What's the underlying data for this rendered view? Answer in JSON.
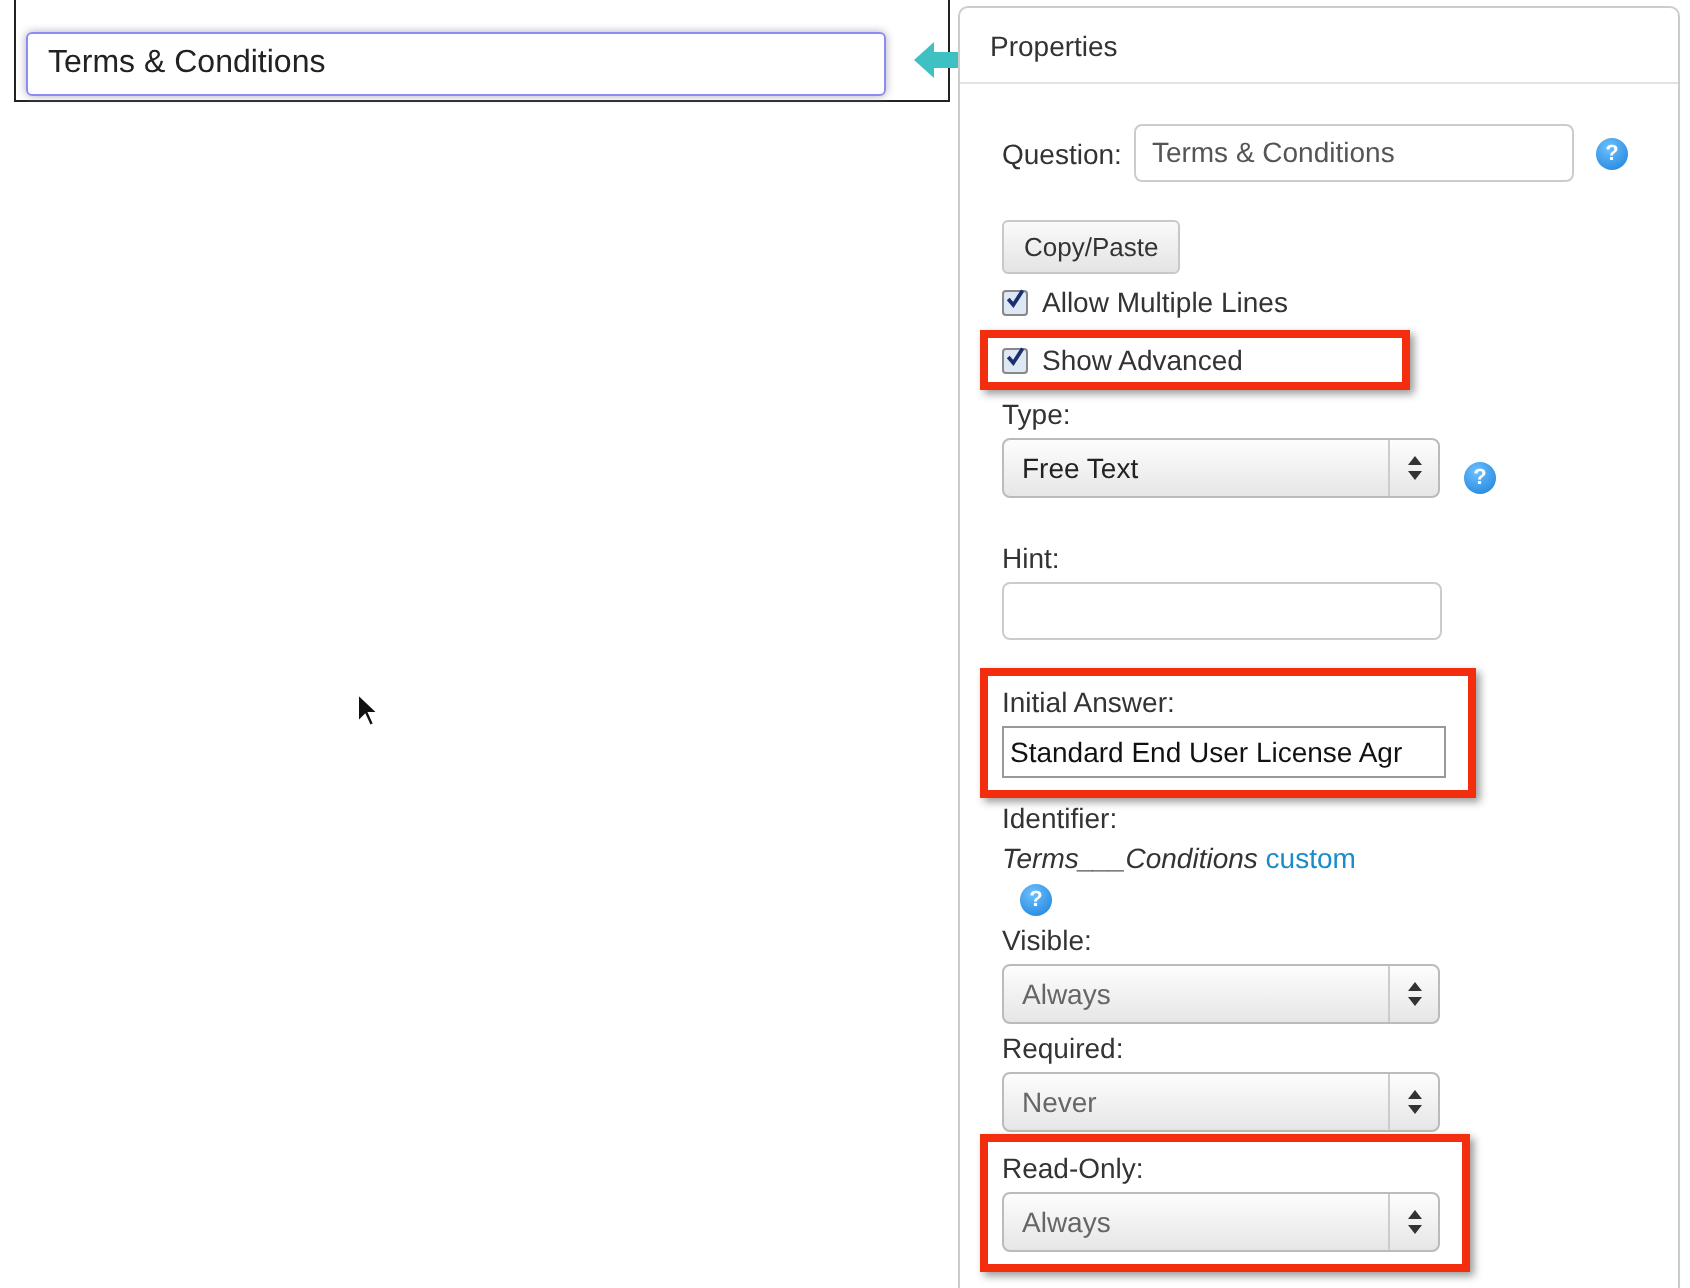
{
  "canvas": {
    "field_value": "Terms & Conditions",
    "focused": true
  },
  "properties": {
    "title": "Properties",
    "question": {
      "label": "Question:",
      "value": "Terms & Conditions",
      "help": "?"
    },
    "copy_button": "Copy/Paste",
    "checkboxes": [
      {
        "label": "Allow Multiple Lines",
        "checked": true,
        "highlighted": false
      },
      {
        "label": "Show Advanced",
        "checked": true,
        "highlighted": true
      }
    ],
    "fields": [
      {
        "kind": "select",
        "label": "Type:",
        "value": "Free Text",
        "disabled": false,
        "help": "?",
        "highlighted": false
      },
      {
        "kind": "text",
        "label": "Hint:",
        "highlighted": false
      },
      {
        "kind": "text",
        "label": "Initial Answer:",
        "value": "Standard End User License Agr",
        "highlighted": true
      },
      {
        "kind": "identifier",
        "label": "Identifier:",
        "value": "Terms___Conditions",
        "link": "custom",
        "help": "?",
        "highlighted": false
      },
      {
        "kind": "select",
        "label": "Visible:",
        "value": "Always",
        "disabled": true,
        "highlighted": false
      },
      {
        "kind": "select",
        "label": "Required:",
        "value": "Never",
        "disabled": true,
        "highlighted": false
      },
      {
        "kind": "select",
        "label": "Read-Only:",
        "value": "Always",
        "disabled": true,
        "highlighted": true
      }
    ]
  }
}
